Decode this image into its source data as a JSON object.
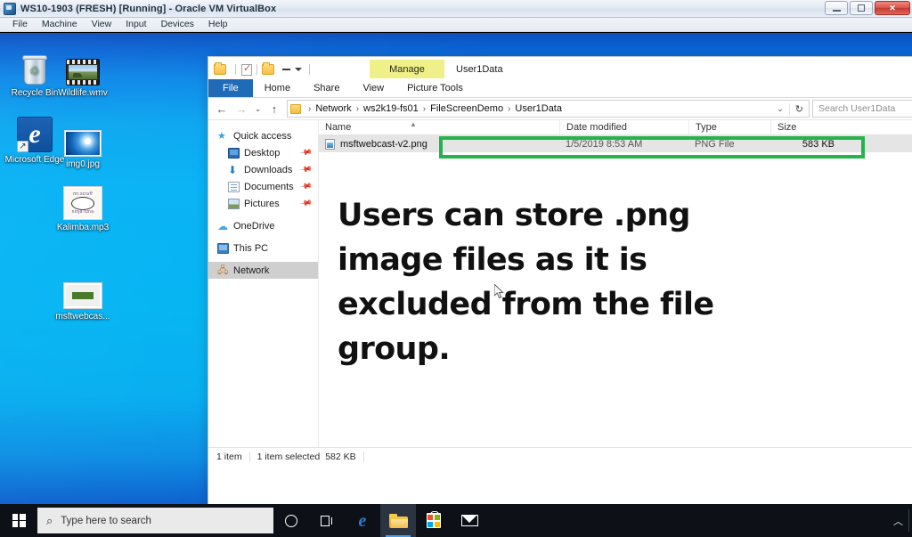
{
  "host_window": {
    "title": "WS10-1903 (FRESH) [Running] - Oracle VM VirtualBox",
    "title_ghost": "",
    "minimize_label": "",
    "maximize_label": "",
    "close_label": "✕",
    "menu": [
      {
        "label": "File"
      },
      {
        "label": "Machine"
      },
      {
        "label": "View"
      },
      {
        "label": "Input"
      },
      {
        "label": "Devices"
      },
      {
        "label": "Help"
      }
    ]
  },
  "desktop": {
    "icons": [
      {
        "label": "Recycle Bin",
        "icon": "recycle-bin-icon"
      },
      {
        "label": "Wildlife.wmv",
        "icon": "video-file-icon"
      },
      {
        "label": "Microsoft Edge",
        "icon": "edge-icon"
      },
      {
        "label": "img0.jpg",
        "icon": "jpg-image-icon"
      },
      {
        "label": "Kalimba.mp3",
        "icon": "mp3-audio-icon"
      },
      {
        "label": "msftwebcas...",
        "icon": "png-image-icon"
      }
    ],
    "mp3_art_top": "mr.scruff",
    "mp3_art_bottom": "ninja tuna"
  },
  "explorer": {
    "quick_access_toolbar": {
      "folder_icon": "folder-icon",
      "properties_icon": "properties-icon",
      "new_folder_icon": "new-folder-icon",
      "customize_icon": "chevron-down-icon"
    },
    "contextual_group": {
      "manage_label": "Manage",
      "window_title": "User1Data"
    },
    "tabs": [
      {
        "label": "File",
        "active": false
      },
      {
        "label": "Home",
        "active": false
      },
      {
        "label": "Share",
        "active": false
      },
      {
        "label": "View",
        "active": false
      },
      {
        "label": "Picture Tools",
        "active": true
      }
    ],
    "address_bar": {
      "back_icon": "back-arrow-icon",
      "forward_icon": "forward-arrow-icon",
      "recent_icon": "chevron-down-icon",
      "up_icon": "up-arrow-icon",
      "folder_icon": "folder-icon",
      "crumbs": [
        "Network",
        "ws2k19-fs01",
        "FileScreenDemo",
        "User1Data"
      ],
      "dropdown_icon": "chevron-down-icon",
      "refresh_icon": "refresh-icon",
      "search_placeholder": "Search User1Data"
    },
    "nav_pane": [
      {
        "label": "Quick access",
        "icon": "star-icon",
        "indent": false,
        "pinned": false,
        "selected": false
      },
      {
        "label": "Desktop",
        "icon": "desktop-icon",
        "indent": true,
        "pinned": true,
        "selected": false
      },
      {
        "label": "Downloads",
        "icon": "downloads-icon",
        "indent": true,
        "pinned": true,
        "selected": false
      },
      {
        "label": "Documents",
        "icon": "documents-icon",
        "indent": true,
        "pinned": true,
        "selected": false
      },
      {
        "label": "Pictures",
        "icon": "pictures-icon",
        "indent": true,
        "pinned": true,
        "selected": false
      },
      {
        "label": "OneDrive",
        "icon": "onedrive-icon",
        "indent": false,
        "pinned": false,
        "selected": false
      },
      {
        "label": "This PC",
        "icon": "this-pc-icon",
        "indent": false,
        "pinned": false,
        "selected": false
      },
      {
        "label": "Network",
        "icon": "network-icon",
        "indent": false,
        "pinned": false,
        "selected": true
      }
    ],
    "columns": [
      "Name",
      "Date modified",
      "Type",
      "Size"
    ],
    "files": [
      {
        "name": "msftwebcast-v2.png",
        "date_modified": "1/5/2019 8:53 AM",
        "type": "PNG File",
        "size": "583 KB",
        "selected": true,
        "highlighted": true
      }
    ],
    "highlight_color": "#25b34b",
    "status_bar": {
      "item_count": "1 item",
      "selection": "1 item selected",
      "selection_size": "582 KB"
    }
  },
  "annotation": {
    "text": "Users can store .png image files as it is excluded from the file group."
  },
  "taskbar": {
    "start_label": "start-button",
    "search_placeholder": "Type here to search",
    "buttons": [
      {
        "name": "cortana-button",
        "label": "Cortana"
      },
      {
        "name": "task-view-button",
        "label": "Task View"
      },
      {
        "name": "edge-button",
        "label": "Microsoft Edge"
      },
      {
        "name": "file-explorer-button",
        "label": "File Explorer"
      },
      {
        "name": "microsoft-store-button",
        "label": "Microsoft Store"
      },
      {
        "name": "mail-button",
        "label": "Mail"
      }
    ],
    "tray_chevron": "︿"
  }
}
